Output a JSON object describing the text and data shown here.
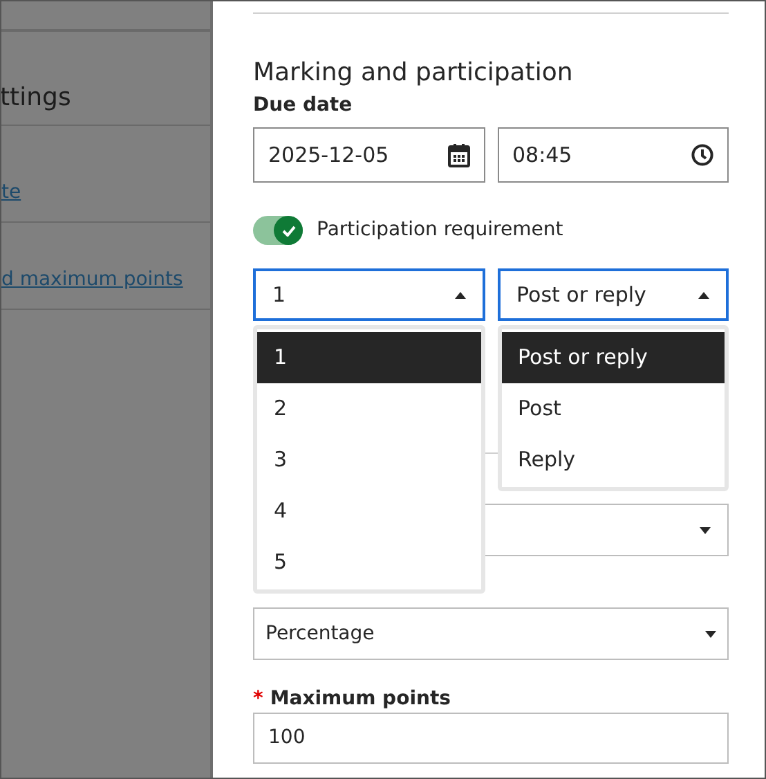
{
  "background": {
    "heading": "ttings",
    "links": [
      "te",
      "d maximum points"
    ]
  },
  "panel": {
    "heading": "Marking and participation",
    "due_date": {
      "label": "Due date",
      "date": "2025-12-05",
      "time": "08:45"
    },
    "participation": {
      "label": "Participation requirement",
      "on": true
    },
    "count_select": {
      "value": "1",
      "expanded": true,
      "options": [
        {
          "label": "1",
          "selected": true
        },
        {
          "label": "2",
          "selected": false
        },
        {
          "label": "3",
          "selected": false
        },
        {
          "label": "4",
          "selected": false
        },
        {
          "label": "5",
          "selected": false
        }
      ]
    },
    "type_select": {
      "value": "Post or reply",
      "expanded": true,
      "options": [
        {
          "label": "Post or reply",
          "selected": true
        },
        {
          "label": "Post",
          "selected": false
        },
        {
          "label": "Reply",
          "selected": false
        }
      ]
    },
    "mark_using": {
      "value": "Percentage"
    },
    "maximum_points": {
      "required_mark": "*",
      "label": "Maximum points",
      "value": "100"
    }
  }
}
